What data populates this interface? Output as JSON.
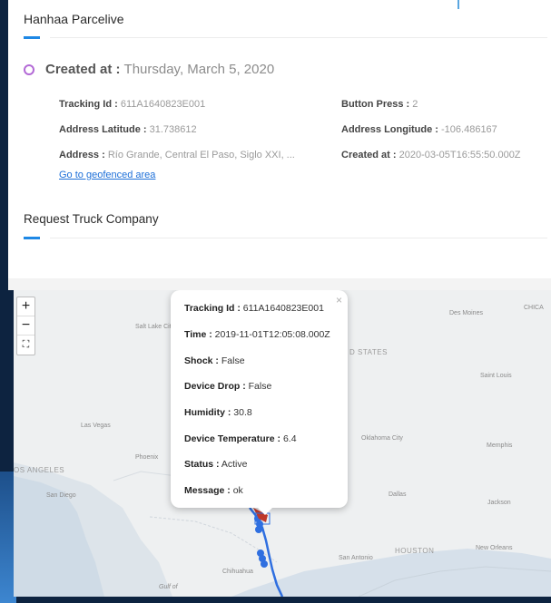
{
  "panel": {
    "title": "Hanhaa Parcelive",
    "created_label": "Created at :",
    "created_value": "Thursday, March 5, 2020",
    "fields": {
      "tracking_label": "Tracking Id :",
      "tracking_value": "611A1640823E001",
      "button_label": "Button Press :",
      "button_value": "2",
      "lat_label": "Address Latitude :",
      "lat_value": "31.738612",
      "lng_label": "Address Longitude :",
      "lng_value": "-106.486167",
      "address_label": "Address :",
      "address_value": "Río Grande, Central El Paso, Siglo XXI, ...",
      "created_label": "Created at :",
      "created_value": "2020-03-05T16:55:50.000Z"
    },
    "geofence_link": "Go to geofenced area"
  },
  "section": {
    "title": "Request Truck Company"
  },
  "map": {
    "zoom_in": "+",
    "zoom_out": "−",
    "fullscreen": "⛶",
    "labels": {
      "salt_lake": "Salt Lake City",
      "des_moines": "Des Moines",
      "chicago": "CHICA",
      "united_states": "D STATES",
      "saint_louis": "Saint Louis",
      "las_vegas": "Las Vegas",
      "oklahoma": "Oklahoma City",
      "memphis": "Memphis",
      "los_angeles": "OS ANGELES",
      "phoenix": "Phoenix",
      "san_diego": "San Diego",
      "dallas": "Dallas",
      "jackson": "Jackson",
      "houston": "HOUSTON",
      "san_antonio": "San Antonio",
      "new_orleans": "New Orleans",
      "chihuahua": "Chihuahua",
      "gulf": "Gulf of"
    }
  },
  "popup": {
    "close": "×",
    "tracking_label": "Tracking Id :",
    "tracking_value": "611A1640823E001",
    "time_label": "Time :",
    "time_value": "2019-11-01T12:05:08.000Z",
    "shock_label": "Shock :",
    "shock_value": "False",
    "drop_label": "Device Drop :",
    "drop_value": "False",
    "humidity_label": "Humidity :",
    "humidity_value": "30.8",
    "temp_label": "Device Temperature :",
    "temp_value": "6.4",
    "status_label": "Status :",
    "status_value": "Active",
    "message_label": "Message :",
    "message_value": "ok"
  },
  "colors": {
    "accent": "#1e88e5",
    "ring": "#b36ad6",
    "route": "#2f6fe0",
    "frame": "#0d2340"
  }
}
